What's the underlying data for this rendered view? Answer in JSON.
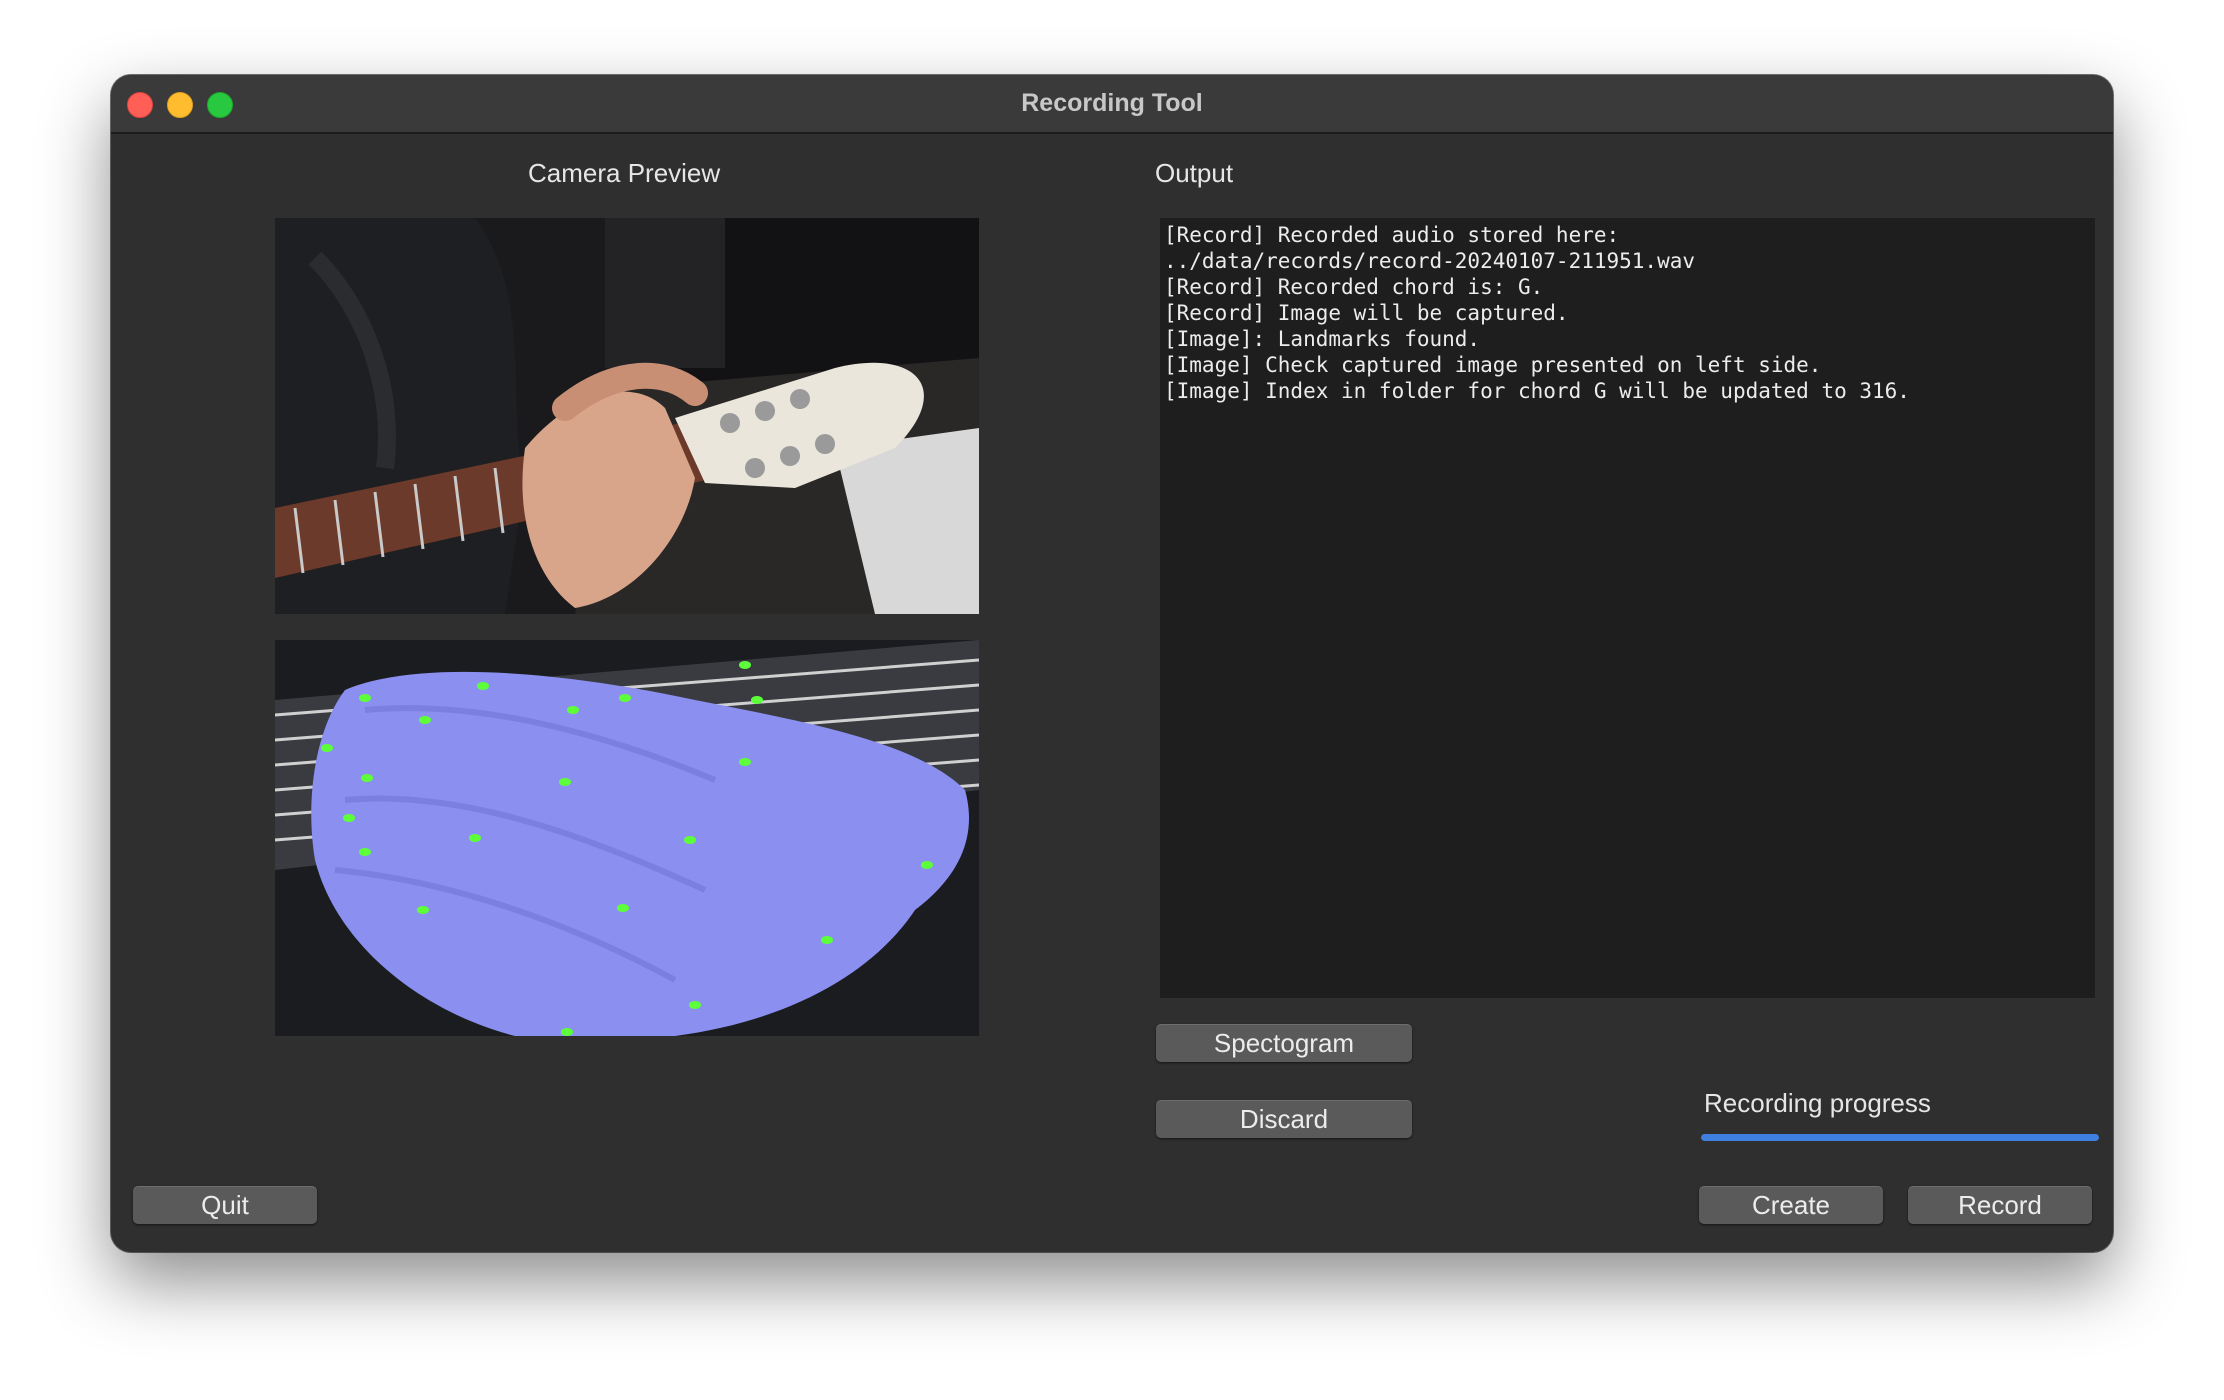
{
  "window": {
    "title": "Recording Tool"
  },
  "camera": {
    "label": "Camera Preview"
  },
  "output": {
    "label": "Output",
    "lines": [
      "[Record] Recorded audio stored here:",
      "../data/records/record-20240107-211951.wav",
      "[Record] Recorded chord is: G.",
      "[Record] Image will be captured.",
      "[Image]: Landmarks found.",
      "[Image] Check captured image presented on left side.",
      "[Image] Index in folder for chord G will be updated to 316."
    ]
  },
  "buttons": {
    "spectogram": "Spectogram",
    "discard": "Discard",
    "quit": "Quit",
    "create": "Create",
    "record": "Record"
  },
  "progress": {
    "label": "Recording progress",
    "value": 1.0,
    "color": "#3f7fe0"
  },
  "colors": {
    "window_bg": "#2f2f2f",
    "output_bg": "#1e1e1e",
    "button_bg": "#5a5a5a",
    "landmark": "#5dff3a",
    "hand_overlay": "#8a8ff0"
  }
}
